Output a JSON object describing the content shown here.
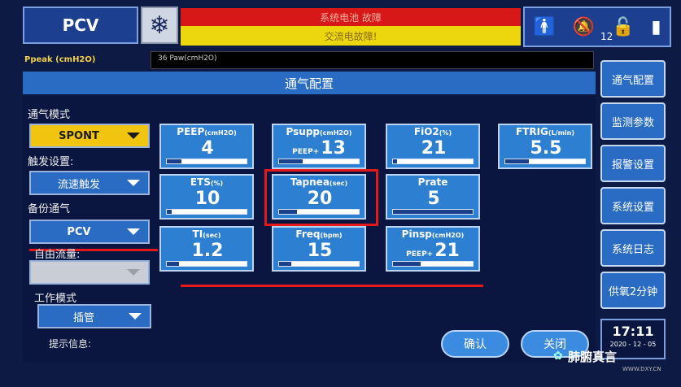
{
  "header": {
    "mode": "PCV",
    "snow_icon": "snowflake-icon",
    "alarm_top": "系统电池  故障",
    "alarm_bottom": "交流电故障!",
    "status_icon_count": "12",
    "ppeak_label": "Ppeak (cmH2O)",
    "graph_label": "36 Paw(cmH2O)"
  },
  "panel": {
    "title": "通气配置",
    "labels": {
      "vent_mode": "通气模式",
      "trigger": "触发设置:",
      "backup": "备份通气",
      "free_flow": "自由流量:",
      "work_mode": "工作模式"
    },
    "dropdowns": {
      "vent_mode": "SPONT",
      "trigger": "流速触发",
      "backup": "PCV",
      "free_flow": "",
      "work_mode": "插管"
    },
    "tiles": [
      {
        "label": "PEEP",
        "unit": "(cmH2O)",
        "prefix": "",
        "value": "4",
        "fill": 0.18
      },
      {
        "label": "Psupp",
        "unit": "(cmH2O)",
        "prefix": "PEEP+",
        "value": "13",
        "fill": 0.3
      },
      {
        "label": "FiO2",
        "unit": "(%)",
        "prefix": "",
        "value": "21",
        "fill": 0.05
      },
      {
        "label": "FTRIG",
        "unit": "(L/min)",
        "prefix": "",
        "value": "5.5",
        "fill": 0.3
      },
      {
        "label": "ETS",
        "unit": "(%)",
        "prefix": "",
        "value": "10",
        "fill": 0.06
      },
      {
        "label": "Tapnea",
        "unit": "(sec)",
        "prefix": "",
        "value": "20",
        "fill": 0.22
      },
      {
        "label": "Prate",
        "unit": "",
        "prefix": "",
        "value": "5",
        "fill": 1.0
      },
      {
        "label": "TI",
        "unit": "(sec)",
        "prefix": "",
        "value": "1.2",
        "fill": 0.15
      },
      {
        "label": "Freq",
        "unit": "(bpm)",
        "prefix": "",
        "value": "15",
        "fill": 0.15
      },
      {
        "label": "Pinsp",
        "unit": "(cmH2O)",
        "prefix": "PEEP+",
        "value": "21",
        "fill": 0.35
      }
    ],
    "prompt": "提示信息:",
    "ok_button": "确认",
    "close_button": "关闭"
  },
  "right_tabs": [
    "通气配置",
    "监测参数",
    "报警设置",
    "系统设置",
    "系统日志",
    "供氧2分钟"
  ],
  "clock": {
    "time": "17:11",
    "date": "2020 - 12 - 05"
  },
  "watermark": {
    "text": "肺腑真言",
    "sub": "WWW.DXY.CN"
  }
}
